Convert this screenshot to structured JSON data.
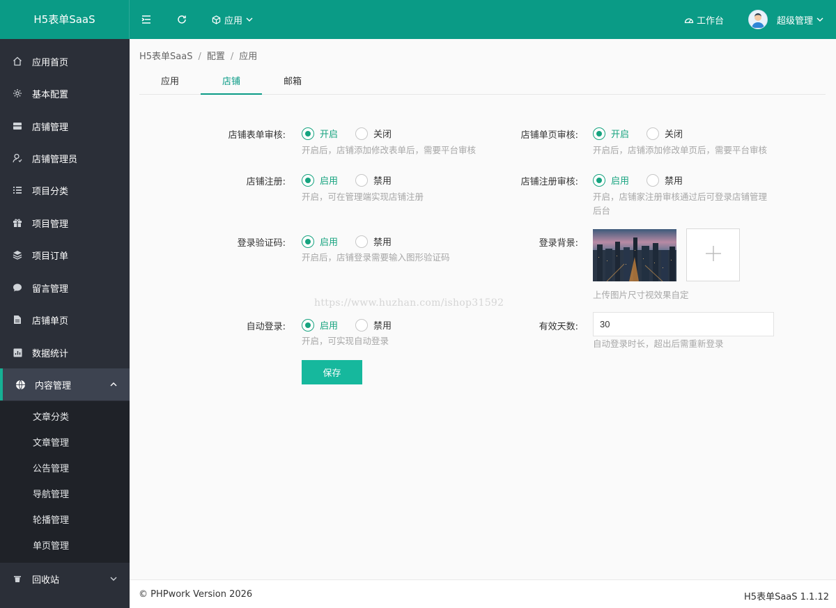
{
  "header": {
    "logo": "H5表单SaaS",
    "app_menu": "应用",
    "workbench": "工作台",
    "user": "超级管理"
  },
  "sidebar": {
    "items": [
      {
        "label": "应用首页",
        "icon": "home-icon"
      },
      {
        "label": "基本配置",
        "icon": "gear-icon"
      },
      {
        "label": "店铺管理",
        "icon": "store-icon"
      },
      {
        "label": "店铺管理员",
        "icon": "user-icon"
      },
      {
        "label": "项目分类",
        "icon": "list-icon"
      },
      {
        "label": "项目管理",
        "icon": "gift-icon"
      },
      {
        "label": "项目订单",
        "icon": "layers-icon"
      },
      {
        "label": "留言管理",
        "icon": "chat-icon"
      },
      {
        "label": "店铺单页",
        "icon": "file-icon"
      },
      {
        "label": "数据统计",
        "icon": "chart-icon"
      },
      {
        "label": "内容管理",
        "icon": "globe-icon"
      }
    ],
    "submenu": [
      "文章分类",
      "文章管理",
      "公告管理",
      "导航管理",
      "轮播管理",
      "单页管理"
    ],
    "recycle": "回收站"
  },
  "breadcrumb": [
    "H5表单SaaS",
    "配置",
    "应用"
  ],
  "tabs": [
    "应用",
    "店铺",
    "邮箱"
  ],
  "form": {
    "shop_form_review": {
      "label": "店铺表单审核:",
      "on": "开启",
      "off": "关闭",
      "hint": "开启后，店铺添加修改表单后，需要平台审核"
    },
    "shop_page_review": {
      "label": "店铺单页审核:",
      "on": "开启",
      "off": "关闭",
      "hint": "开启后，店铺添加修改单页后，需要平台审核"
    },
    "shop_register": {
      "label": "店铺注册:",
      "on": "启用",
      "off": "禁用",
      "hint": "开启，可在管理端实现店铺注册"
    },
    "shop_register_review": {
      "label": "店铺注册审核:",
      "on": "启用",
      "off": "禁用",
      "hint_1": "开启，店铺家注册审核通过后可登录店铺管理",
      "hint_2": "后台"
    },
    "login_captcha": {
      "label": "登录验证码:",
      "on": "启用",
      "off": "禁用",
      "hint": "开启后，店铺登录需要输入图形验证码"
    },
    "login_background": {
      "label": "登录背景:",
      "hint": "上传图片尺寸视效果自定"
    },
    "auto_login": {
      "label": "自动登录:",
      "on": "启用",
      "off": "禁用",
      "hint": "开启，可实现自动登录"
    },
    "valid_days": {
      "label": "有效天数:",
      "value": "30",
      "hint": "自动登录时长，超出后需重新登录"
    },
    "save": "保存"
  },
  "watermark": "https://www.huzhan.com/ishop31592",
  "footer": {
    "copyright": "© PHPwork Version 2026",
    "version": "H5表单SaaS 1.1.12"
  },
  "colors": {
    "header": "#0a9b86",
    "sidebar": "#2b2f38",
    "accent": "#16a37f",
    "button": "#16b89d"
  }
}
